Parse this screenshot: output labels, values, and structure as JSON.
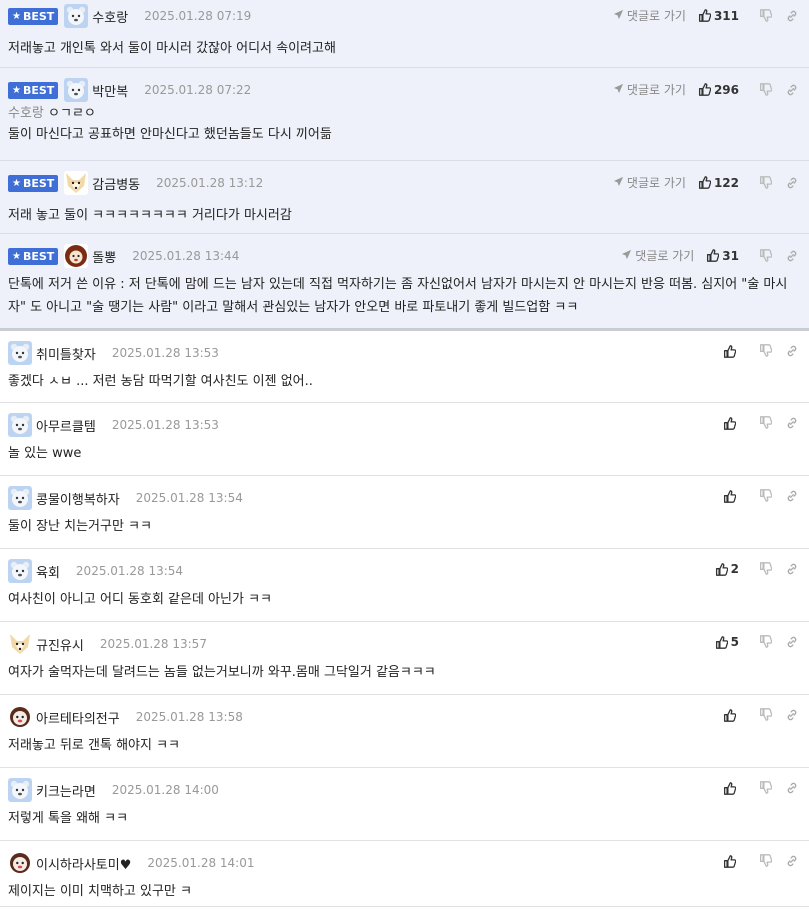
{
  "labels": {
    "best": "BEST",
    "reply_link": "댓글로 가기"
  },
  "colors": {
    "best_bg": "#eef1f9",
    "badge": "#3f6fd6"
  },
  "best_comments": [
    {
      "nick": "수호랑",
      "date": "2025.01.28 07:19",
      "likes": "311",
      "avatar": "bear-avatar",
      "quote_nick": "",
      "quote_text": "",
      "text": "저래놓고 개인톡 와서 둘이 마시러 갔잖아 어디서 속이려고해"
    },
    {
      "nick": "박만복",
      "date": "2025.01.28 07:22",
      "likes": "296",
      "avatar": "bear-avatar",
      "quote_nick": "수호랑",
      "quote_text": "ㅇㄱㄹㅇ",
      "text": "둘이 마신다고 공표하면 안마신다고 했던놈들도 다시 끼어듦"
    },
    {
      "nick": "감금병동",
      "date": "2025.01.28 13:12",
      "likes": "122",
      "avatar": "fox-avatar",
      "quote_nick": "",
      "quote_text": "",
      "text": "저래 놓고 둘이 ㅋㅋㅋㅋㅋㅋㅋㅋ 거리다가 마시러감"
    },
    {
      "nick": "돌뽕",
      "date": "2025.01.28 13:44",
      "likes": "31",
      "avatar": "lion-avatar",
      "quote_nick": "",
      "quote_text": "",
      "text": "단톡에 저거 쓴 이유 : 저 단톡에 맘에 드는 남자 있는데 직접 먹자하기는 좀 자신없어서 남자가 마시는지 안 마시는지 반응 떠봄. 심지어 \"술 마시자\" 도 아니고 \"술 땡기는 사람\" 이라고 말해서 관심있는 남자가 안오면 바로 파토내기 좋게 빌드업함 ㅋㅋ"
    }
  ],
  "comments": [
    {
      "nick": "취미틀찾자",
      "date": "2025.01.28 13:53",
      "likes": "",
      "avatar": "bear-avatar",
      "text": "좋겠다 ㅅㅂ ... 저런 농담 따먹기할 여사친도 이젠 없어.."
    },
    {
      "nick": "아무르클템",
      "date": "2025.01.28 13:53",
      "likes": "",
      "avatar": "bear-avatar",
      "text": "놀 있는 wwe"
    },
    {
      "nick": "콩물이행복하자",
      "date": "2025.01.28 13:54",
      "likes": "",
      "avatar": "bear-avatar",
      "text": "둘이 장난 치는거구만 ㅋㅋ"
    },
    {
      "nick": "육회",
      "date": "2025.01.28 13:54",
      "likes": "2",
      "avatar": "bear-avatar",
      "text": "여사친이 아니고 어디 동호회 같은데 아닌가 ㅋㅋ"
    },
    {
      "nick": "규진유시",
      "date": "2025.01.28 13:57",
      "likes": "5",
      "avatar": "fox-avatar",
      "text": "여자가 술먹자는데 달려드는 놈들 없는거보니까 와꾸.몸매 그닥일거 같음ㅋㅋㅋ"
    },
    {
      "nick": "아르테타의전구",
      "date": "2025.01.28 13:58",
      "likes": "",
      "avatar": "dog-avatar",
      "text": "저래놓고 뒤로 갠톡 해야지 ㅋㅋ"
    },
    {
      "nick": "키크는라면",
      "date": "2025.01.28 14:00",
      "likes": "",
      "avatar": "bear-avatar",
      "text": "저렇게 톡을 왜해 ㅋㅋ"
    },
    {
      "nick": "이시하라사토미♥",
      "date": "2025.01.28 14:01",
      "likes": "",
      "avatar": "dog-avatar",
      "text": "제이지는 이미 치맥하고 있구만 ㅋ"
    }
  ]
}
